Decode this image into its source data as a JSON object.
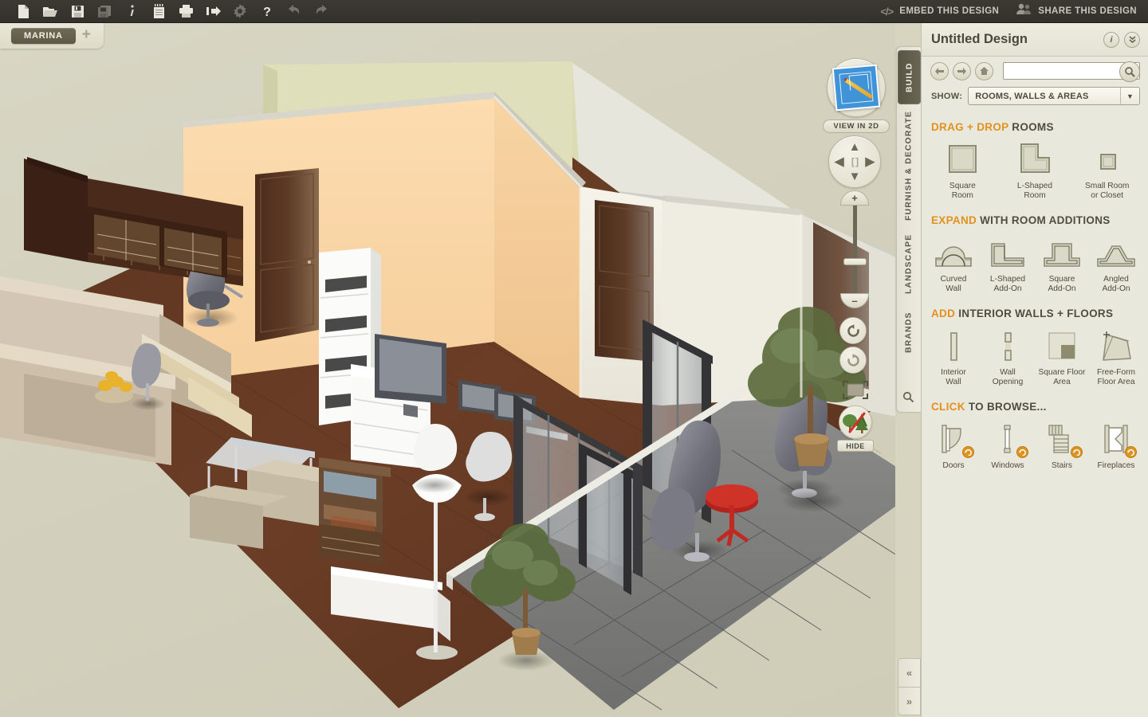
{
  "toolbar": {
    "buttons": [
      {
        "name": "new-document-icon",
        "label": "New",
        "dim": false
      },
      {
        "name": "open-folder-icon",
        "label": "Open",
        "dim": false
      },
      {
        "name": "save-icon",
        "label": "Save",
        "dim": false
      },
      {
        "name": "save-as-icon",
        "label": "Save As",
        "dim": true
      },
      {
        "name": "info-icon",
        "label": "Info",
        "dim": false
      },
      {
        "name": "notepad-icon",
        "label": "Notes",
        "dim": false
      },
      {
        "name": "print-icon",
        "label": "Print",
        "dim": false
      },
      {
        "name": "export-icon",
        "label": "Export",
        "dim": false
      },
      {
        "name": "settings-gear-icon",
        "label": "Settings",
        "dim": true
      },
      {
        "name": "help-icon",
        "label": "Help",
        "dim": false
      },
      {
        "name": "undo-icon",
        "label": "Undo",
        "dim": true
      },
      {
        "name": "redo-icon",
        "label": "Redo",
        "dim": true
      }
    ],
    "embed_label": "EMBED THIS DESIGN",
    "share_label": "SHARE THIS DESIGN"
  },
  "tabs": {
    "active": "MARINA",
    "add_label": "+"
  },
  "viewport": {
    "view_2d_label": "VIEW IN 2D",
    "hide_label": "HIDE",
    "zoom_plus": "+",
    "zoom_minus": "–",
    "dpad": {
      "up": "▲",
      "down": "▼",
      "left": "◀",
      "right": "▶",
      "center": "[ ]"
    }
  },
  "rail": {
    "tabs": [
      {
        "label": "BUILD",
        "active": true
      },
      {
        "label": "FURNISH & DECORATE",
        "active": false
      },
      {
        "label": "LANDSCAPE",
        "active": false
      },
      {
        "label": "BRANDS",
        "active": false
      }
    ],
    "search_icon": "search-icon"
  },
  "panel": {
    "title": "Untitled Design",
    "info_icon": "i",
    "collapse_icon": "»",
    "search": {
      "value": "",
      "placeholder": ""
    },
    "show_label": "SHOW:",
    "show_value": "ROOMS, WALLS & AREAS",
    "sections": [
      {
        "highlight": "DRAG + DROP",
        "rest": "ROOMS",
        "items": [
          {
            "icon": "square-room-icon",
            "caption": "Square\nRoom",
            "badge": false
          },
          {
            "icon": "l-shaped-room-icon",
            "caption": "L-Shaped\nRoom",
            "badge": false
          },
          {
            "icon": "small-room-closet-icon",
            "caption": "Small Room\nor Closet",
            "badge": false
          }
        ]
      },
      {
        "highlight": "EXPAND",
        "rest": "WITH ROOM ADDITIONS",
        "items": [
          {
            "icon": "curved-wall-icon",
            "caption": "Curved\nWall",
            "badge": false
          },
          {
            "icon": "l-shaped-addon-icon",
            "caption": "L-Shaped\nAdd-On",
            "badge": false
          },
          {
            "icon": "square-addon-icon",
            "caption": "Square\nAdd-On",
            "badge": false
          },
          {
            "icon": "angled-addon-icon",
            "caption": "Angled\nAdd-On",
            "badge": false
          }
        ]
      },
      {
        "highlight": "ADD",
        "rest": "INTERIOR WALLS + FLOORS",
        "items": [
          {
            "icon": "interior-wall-icon",
            "caption": "Interior\nWall",
            "badge": false
          },
          {
            "icon": "wall-opening-icon",
            "caption": "Wall\nOpening",
            "badge": false
          },
          {
            "icon": "square-floor-area-icon",
            "caption": "Square Floor\nArea",
            "badge": false
          },
          {
            "icon": "free-form-floor-area-icon",
            "caption": "Free-Form\nFloor Area",
            "badge": false
          }
        ]
      },
      {
        "highlight": "CLICK",
        "rest": "TO BROWSE...",
        "items": [
          {
            "icon": "doors-icon",
            "caption": "Doors",
            "badge": true
          },
          {
            "icon": "windows-icon",
            "caption": "Windows",
            "badge": true
          },
          {
            "icon": "stairs-icon",
            "caption": "Stairs",
            "badge": true
          },
          {
            "icon": "fireplaces-icon",
            "caption": "Fireplaces",
            "badge": true
          }
        ]
      }
    ]
  },
  "collapse": {
    "prev": "«",
    "next": "»"
  },
  "colors": {
    "accent_orange": "#e2911f",
    "toolbar_dark": "#3b3932",
    "panel_bg": "#e9e8dc",
    "tab_active": "#5d5946",
    "canvas_bg": "#d5d3bf"
  }
}
